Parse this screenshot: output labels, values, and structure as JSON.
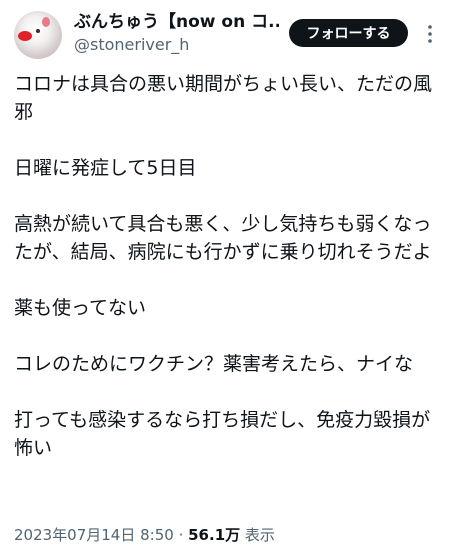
{
  "user": {
    "display_name": "ぶんちゅう【now on コ...",
    "handle": "@stoneriver_h"
  },
  "follow_button_label": "フォローする",
  "tweet": {
    "paragraphs": [
      "コロナは具合の悪い期間がちょい長い、ただの風邪",
      "日曜に発症して5日目",
      "高熱が続いて具合も悪く、少し気持ちも弱くなったが、結局、病院にも行かずに乗り切れそうだよ",
      "薬も使ってない",
      "コレのためにワクチン？薬害考えたら、ナイな",
      "打っても感染するなら打ち損だし、免疫力毀損が怖い"
    ]
  },
  "meta": {
    "timestamp": "2023年07月14日 8:50",
    "separator": " · ",
    "views_count": "56.1万",
    "views_label": "表示"
  },
  "icons": {
    "avatar": "java-sparrow-avatar",
    "more": "more-dots-icon"
  },
  "colors": {
    "text": "#0f1419",
    "secondary": "#536471",
    "button_bg": "#0f1419",
    "button_text": "#ffffff"
  }
}
